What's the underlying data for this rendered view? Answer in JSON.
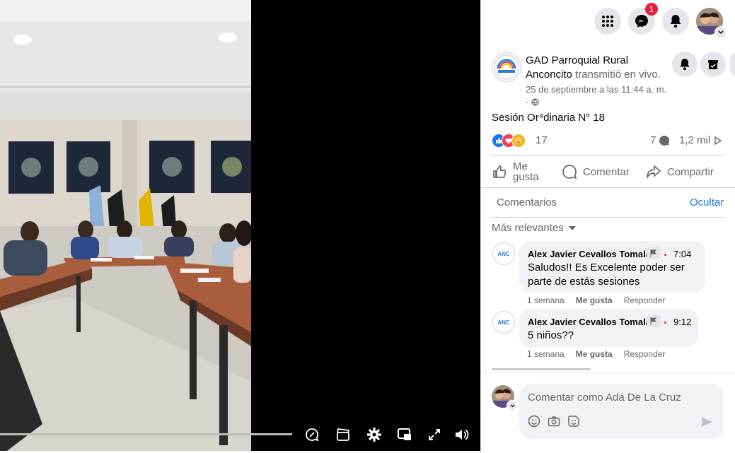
{
  "post": {
    "page_name": "GAD Parroquial Rural Anconcito",
    "action_text": "transmitió en vivo.",
    "date": "25 de septiembre a las 11:44 a. m.",
    "privacy_separator": "·",
    "title": "Sesión Or⁴dinaria N° 18",
    "reactions_count": "17",
    "comments_count": "7",
    "views_count": "1,2 mil"
  },
  "actions": {
    "like_label": "Me gusta",
    "comment_label": "Comentar",
    "share_label": "Compartir"
  },
  "comments_section": {
    "header": "Comentarios",
    "hide_label": "Ocultar",
    "sort_label": "Más relevantes"
  },
  "comments": [
    {
      "author": "Alex Javier Cevallos Tomalá",
      "time": "7:04",
      "text": "Saludos!! Es Excelente poder ser parte de estás sesiones",
      "age": "1 semana",
      "like": "Me gusta",
      "reply": "Responder",
      "avatar_text": "ANC"
    },
    {
      "author": "Alex Javier Cevallos Tomalá",
      "time": "9:12",
      "text": "5 niños??",
      "age": "1 semana",
      "like": "Me gusta",
      "reply": "Responder",
      "avatar_text": "ANC"
    }
  ],
  "composer": {
    "placeholder": "Comentar como Ada De La Cruz"
  },
  "header": {
    "messenger_badge": "1"
  },
  "video": {
    "progress": 1.0
  },
  "colors": {
    "accent": "#1877f2",
    "badge": "#e41e3f",
    "video_bg": "#000000"
  }
}
